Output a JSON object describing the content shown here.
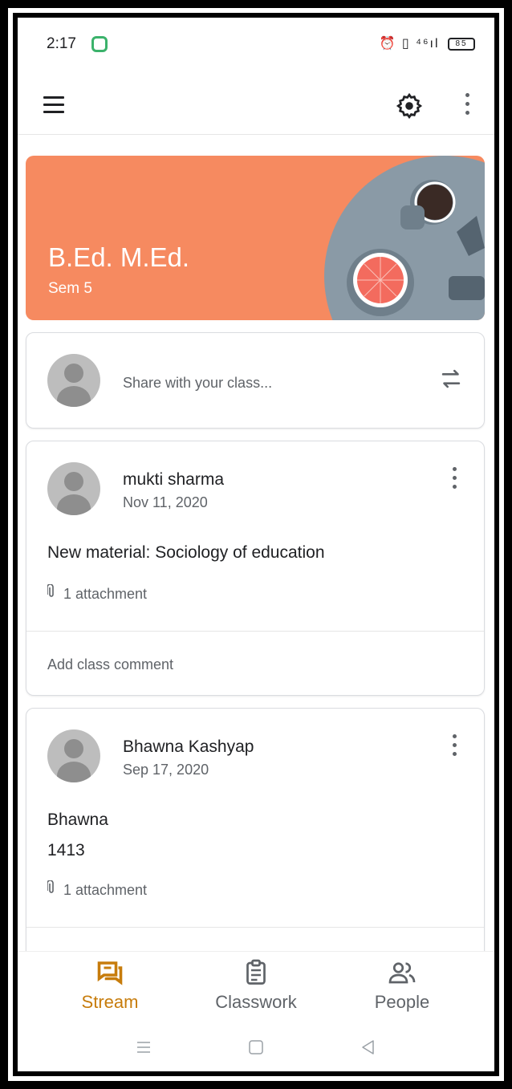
{
  "status_bar": {
    "time": "2:17",
    "right_icons": "⏰ ▯ ⁴⁶ıl",
    "battery": "85"
  },
  "app_bar": {
    "menu_icon": "menu-icon",
    "settings_icon": "gear-icon",
    "more_icon": "more-vert-icon"
  },
  "banner": {
    "title": "B.Ed. M.Ed.",
    "subtitle": "Sem 5",
    "color": "#f68a60"
  },
  "share": {
    "placeholder": "Share with your class...",
    "repost_icon": "repost-icon"
  },
  "posts": [
    {
      "author": "mukti sharma",
      "date": "Nov 11, 2020",
      "body": [
        "New material: Sociology of education"
      ],
      "attachments": "1 attachment",
      "comment_prompt": "Add class comment"
    },
    {
      "author": "Bhawna Kashyap",
      "date": "Sep 17, 2020",
      "body": [
        "Bhawna",
        "1413"
      ],
      "attachments": "1 attachment"
    }
  ],
  "bottom_nav": {
    "items": [
      {
        "label": "Stream",
        "icon": "stream-icon",
        "active": true
      },
      {
        "label": "Classwork",
        "icon": "classwork-icon",
        "active": false
      },
      {
        "label": "People",
        "icon": "people-icon",
        "active": false
      }
    ],
    "active_color": "#c77c0c"
  },
  "system_nav": {
    "buttons": [
      "recents-icon",
      "home-icon",
      "back-icon"
    ]
  }
}
